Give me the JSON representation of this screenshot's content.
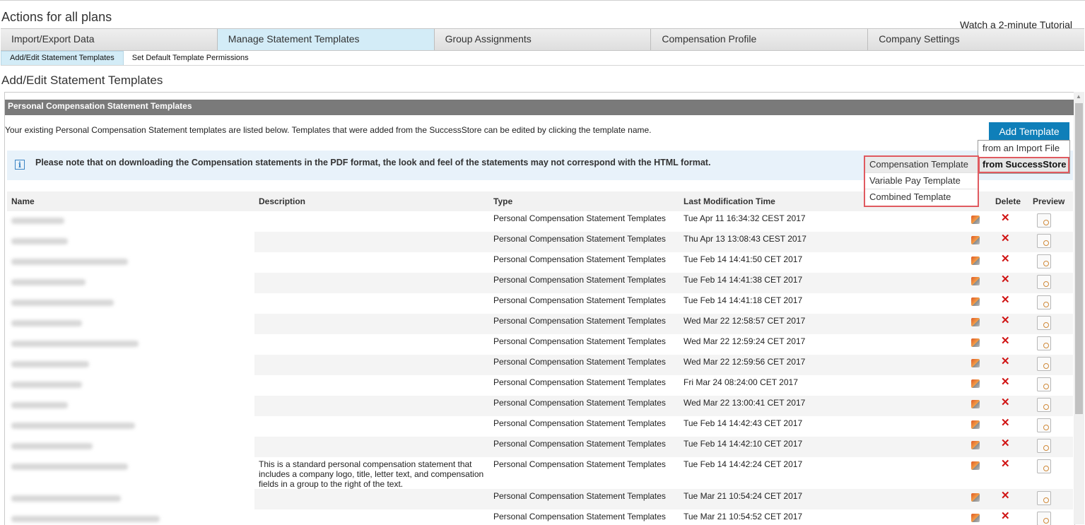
{
  "page": {
    "title": "Actions for all plans",
    "tutorial_link": "Watch a 2-minute Tutorial"
  },
  "main_tabs": [
    "Import/Export Data",
    "Manage Statement Templates",
    "Group Assignments",
    "Compensation Profile",
    "Company Settings"
  ],
  "sub_tabs": [
    "Add/Edit Statement Templates",
    "Set Default Template Permissions"
  ],
  "section_title": "Add/Edit Statement Templates",
  "panel": {
    "header": "Personal Compensation Statement Templates",
    "intro": "Your existing Personal Compensation Statement templates are listed below. Templates that were added from the SuccessStore can be edited by clicking the template name.",
    "add_button": "Add Template",
    "notice": "Please note that on downloading the Compensation statements in the PDF format, the look and feel of the statements may not correspond with the HTML format.",
    "info_icon_glyph": "i"
  },
  "add_menu": {
    "sources": [
      "from an Import File",
      "from SuccessStore"
    ],
    "template_types": [
      "Compensation Template",
      "Variable Pay Template",
      "Combined Template"
    ]
  },
  "table": {
    "columns": {
      "name": "Name",
      "description": "Description",
      "type": "Type",
      "modified": "Last Modification Time",
      "export": "ort",
      "delete": "Delete",
      "preview": "Preview"
    },
    "rows": [
      {
        "description": "",
        "type": "Personal Compensation Statement Templates",
        "modified": "Tue Apr 11 16:34:32 CEST 2017"
      },
      {
        "description": "",
        "type": "Personal Compensation Statement Templates",
        "modified": "Thu Apr 13 13:08:43 CEST 2017"
      },
      {
        "description": "",
        "type": "Personal Compensation Statement Templates",
        "modified": "Tue Feb 14 14:41:50 CET 2017"
      },
      {
        "description": "",
        "type": "Personal Compensation Statement Templates",
        "modified": "Tue Feb 14 14:41:38 CET 2017"
      },
      {
        "description": "",
        "type": "Personal Compensation Statement Templates",
        "modified": "Tue Feb 14 14:41:18 CET 2017"
      },
      {
        "description": "",
        "type": "Personal Compensation Statement Templates",
        "modified": "Wed Mar 22 12:58:57 CET 2017"
      },
      {
        "description": "",
        "type": "Personal Compensation Statement Templates",
        "modified": "Wed Mar 22 12:59:24 CET 2017"
      },
      {
        "description": "",
        "type": "Personal Compensation Statement Templates",
        "modified": "Wed Mar 22 12:59:56 CET 2017"
      },
      {
        "description": "",
        "type": "Personal Compensation Statement Templates",
        "modified": "Fri Mar 24 08:24:00 CET 2017"
      },
      {
        "description": "",
        "type": "Personal Compensation Statement Templates",
        "modified": "Wed Mar 22 13:00:41 CET 2017"
      },
      {
        "description": "",
        "type": "Personal Compensation Statement Templates",
        "modified": "Tue Feb 14 14:42:43 CET 2017"
      },
      {
        "description": "",
        "type": "Personal Compensation Statement Templates",
        "modified": "Tue Feb 14 14:42:10 CET 2017"
      },
      {
        "description": "This is a standard personal compensation statement that includes a company logo, title, letter text, and compensation fields in a group to the right of the text.",
        "type": "Personal Compensation Statement Templates",
        "modified": "Tue Feb 14 14:42:24 CET 2017"
      },
      {
        "description": "",
        "type": "Personal Compensation Statement Templates",
        "modified": "Tue Mar 21 10:54:24 CET 2017"
      },
      {
        "description": "",
        "type": "Personal Compensation Statement Templates",
        "modified": "Tue Mar 21 10:54:52 CET 2017"
      }
    ],
    "delete_glyph": "✕"
  }
}
